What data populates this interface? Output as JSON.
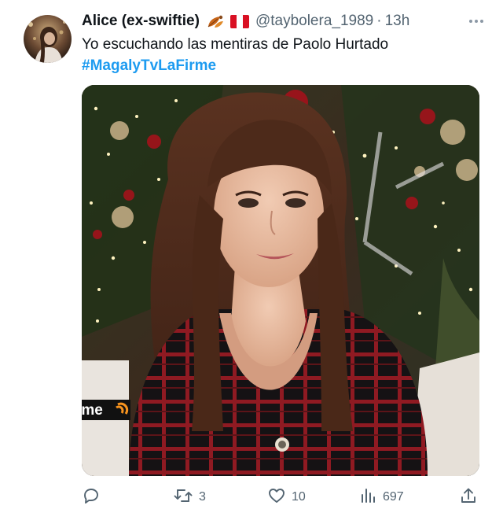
{
  "author": {
    "display_name": "Alice (ex-swiftie)",
    "handle": "@taybolera_1989",
    "separator": "·",
    "time": "13h"
  },
  "emojis": [
    "leaves-emoji",
    "peru-flag-emoji"
  ],
  "tweet": {
    "text": "Yo escuchando las mentiras de Paolo Hurtado",
    "hashtag": "#MagalyTvLaFirme"
  },
  "media": {
    "watermark": "trome"
  },
  "actions": {
    "retweets": "3",
    "likes": "10",
    "views": "697"
  },
  "icons": [
    "more-icon",
    "reply-icon",
    "retweet-icon",
    "like-icon",
    "views-icon",
    "share-icon"
  ],
  "colors": {
    "link": "#1d9bf0",
    "secondary_text": "#536471",
    "watermark_accent": "#f7931e"
  }
}
